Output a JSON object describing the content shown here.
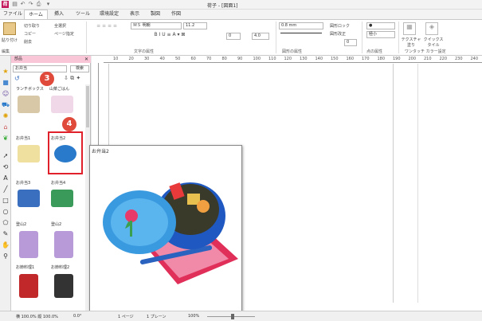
{
  "app": {
    "title": "荷子 - [図面1]",
    "icon_letter": "荷"
  },
  "tabs": [
    "ファイル",
    "ホーム",
    "挿入",
    "ツール",
    "環境設定",
    "表示",
    "製図",
    "作図"
  ],
  "ribbon": {
    "paste_label": "貼り付け",
    "cut_label": "切り取り",
    "copy_label": "コピー",
    "clear_label": "削去",
    "select_all_label": "全選択",
    "page_spec_label": "ページ指定",
    "edit_group": "編集",
    "font_name": "ＭＳ 明朝",
    "font_size": "11.2",
    "char_spacing": "0",
    "line_spacing": "4.0",
    "text_group": "文字の属性",
    "line_width": "0.8 mm",
    "shape_lock_label": "図形ロック",
    "shape_edit_label": "図形改正",
    "shape_num": "0",
    "shape_group": "図形の属性",
    "point_size": "極小",
    "point_group": "点の属性",
    "texture_label": "テクスチャ塗り",
    "quick_style_label": "クイックスタイル",
    "color_group": "ワンタッチ カラー設定"
  },
  "panel": {
    "title": "部品",
    "search_value": "お弁当",
    "search_button": "検索",
    "items": [
      "ランチボックス",
      "山菜ごはん",
      "お弁当1",
      "お弁当2",
      "お弁当3",
      "お弁当4",
      "登山2",
      "登山2",
      "お節料理1",
      "お節料理2"
    ]
  },
  "preview": {
    "title": "お弁当2"
  },
  "callouts": [
    "3",
    "4"
  ],
  "ruler": {
    "ticks": [
      "10",
      "20",
      "30",
      "40",
      "50",
      "60",
      "70",
      "80",
      "90",
      "100",
      "110",
      "120",
      "130",
      "140",
      "150",
      "160",
      "170",
      "180",
      "190",
      "200",
      "210",
      "220",
      "230",
      "240"
    ]
  },
  "status": {
    "scale_text": "横 100.0% 縦 100.0%",
    "angle_text": "0.0°",
    "page_text": "1 ページ",
    "plane_text": "1 プレーン",
    "zoom_text": "100%"
  },
  "colors": {
    "accent": "#e04a3a",
    "panel_head": "#f8c6d6"
  }
}
